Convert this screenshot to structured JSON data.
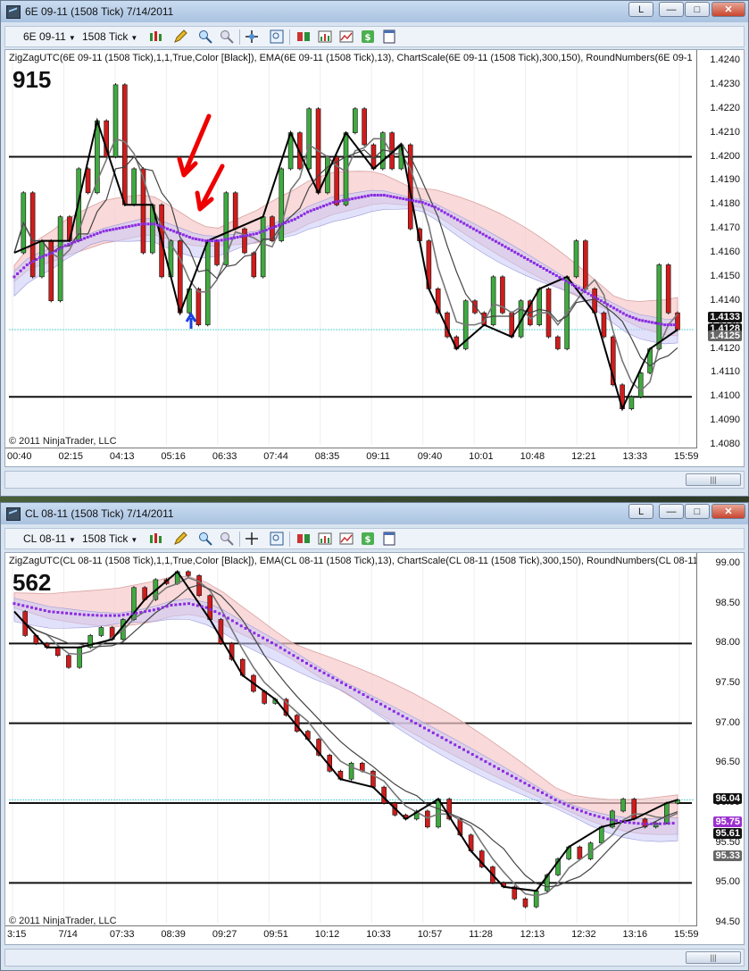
{
  "windows": [
    {
      "title": "6E 09-11 (1508 Tick)  7/14/2011",
      "buttons": {
        "l": "L",
        "minimize": "—",
        "maximize": "□",
        "close": "✕"
      },
      "toolbar": {
        "instrument": "6E 09-11",
        "interval": "1508 Tick"
      },
      "indicators": "ZigZagUTC(6E 09-11 (1508 Tick),1,1,True,Color [Black]), EMA(6E 09-11 (1508 Tick),13), ChartScale(6E 09-11 (1508 Tick),300,150), RoundNumbers(6E 09-1",
      "big_number": "915",
      "copyright": "© 2011 NinjaTrader, LLC",
      "price_ticks": [
        "1.4240",
        "1.4230",
        "1.4220",
        "1.4210",
        "1.4200",
        "1.4190",
        "1.4180",
        "1.4170",
        "1.4160",
        "1.4150",
        "1.4140",
        "1.4130",
        "1.4120",
        "1.4110",
        "1.4100",
        "1.4090",
        "1.4080"
      ],
      "price_labels": [
        {
          "text": "1.4133",
          "value": 1.4133,
          "color": "#111111"
        },
        {
          "text": "1.4128",
          "value": 1.4128,
          "color": "#111111"
        },
        {
          "text": "1.4125",
          "value": 1.4125,
          "color": "#666666"
        }
      ],
      "time_labels": [
        "00:40",
        "02:15",
        "04:13",
        "05:16",
        "06:33",
        "07:44",
        "08:35",
        "09:11",
        "09:40",
        "10:01",
        "10:48",
        "12:21",
        "13:33",
        "15:59"
      ]
    },
    {
      "title": "CL 08-11 (1508 Tick)  7/14/2011",
      "buttons": {
        "l": "L",
        "minimize": "—",
        "maximize": "□",
        "close": "✕"
      },
      "toolbar": {
        "instrument": "CL 08-11",
        "interval": "1508 Tick"
      },
      "indicators": "ZigZagUTC(CL 08-11 (1508 Tick),1,1,True,Color [Black]), EMA(CL 08-11 (1508 Tick),13), ChartScale(CL 08-11 (1508 Tick),300,150), RoundNumbers(CL 08-11",
      "big_number": "562",
      "copyright": "© 2011 NinjaTrader, LLC",
      "price_ticks": [
        "99.00",
        "98.50",
        "98.00",
        "97.50",
        "97.00",
        "96.50",
        "96.00",
        "95.50",
        "95.00",
        "94.50"
      ],
      "price_labels": [
        {
          "text": "96.04",
          "value": 96.04,
          "color": "#111111"
        },
        {
          "text": "95.75",
          "value": 95.75,
          "color": "#9b2fd0"
        },
        {
          "text": "95.61",
          "value": 95.61,
          "color": "#111111"
        },
        {
          "text": "95.33",
          "value": 95.33,
          "color": "#666666"
        }
      ],
      "time_labels": [
        "3:15",
        "7/14",
        "07:33",
        "08:39",
        "09:27",
        "09:51",
        "10:12",
        "10:33",
        "10:57",
        "11:28",
        "12:13",
        "12:32",
        "13:16",
        "15:59"
      ]
    }
  ],
  "chart_data": [
    {
      "type": "line",
      "instrument": "6E 09-11",
      "ylim": [
        1.408,
        1.424
      ],
      "horizontal_lines": [
        1.42,
        1.41
      ],
      "current_price": 1.4128,
      "close_series": [
        1.416,
        1.4185,
        1.415,
        1.4165,
        1.414,
        1.4175,
        1.4165,
        1.4195,
        1.4185,
        1.4215,
        1.42,
        1.423,
        1.418,
        1.4195,
        1.416,
        1.418,
        1.415,
        1.4165,
        1.4135,
        1.4145,
        1.413,
        1.4165,
        1.4155,
        1.4185,
        1.417,
        1.416,
        1.415,
        1.4175,
        1.4165,
        1.4195,
        1.421,
        1.4195,
        1.422,
        1.4185,
        1.42,
        1.418,
        1.421,
        1.422,
        1.4205,
        1.4195,
        1.421,
        1.4195,
        1.4205,
        1.417,
        1.4165,
        1.4145,
        1.4135,
        1.4125,
        1.412,
        1.414,
        1.4135,
        1.413,
        1.415,
        1.4135,
        1.4125,
        1.414,
        1.413,
        1.4145,
        1.4125,
        1.412,
        1.415,
        1.4165,
        1.4145,
        1.4135,
        1.4125,
        1.4105,
        1.4095,
        1.41,
        1.411,
        1.412,
        1.4155,
        1.4135,
        1.4128
      ],
      "ema_series": [
        1.415,
        1.4155,
        1.4158,
        1.416,
        1.4163,
        1.4165,
        1.4167,
        1.4169,
        1.417,
        1.4171,
        1.4172,
        1.4172,
        1.417,
        1.4168,
        1.4166,
        1.4165,
        1.4165,
        1.4166,
        1.4167,
        1.4168,
        1.417,
        1.4172,
        1.4174,
        1.4177,
        1.4179,
        1.4181,
        1.4182,
        1.4183,
        1.4184,
        1.4184,
        1.4183,
        1.4182,
        1.4181,
        1.4179,
        1.4176,
        1.4173,
        1.417,
        1.4167,
        1.4164,
        1.4161,
        1.4158,
        1.4155,
        1.4152,
        1.4149,
        1.4146,
        1.4143,
        1.414,
        1.4137,
        1.4134,
        1.4132,
        1.4131,
        1.413,
        1.413
      ],
      "arrow_annotations": 2
    },
    {
      "type": "line",
      "instrument": "CL 08-11",
      "ylim": [
        94.5,
        99.0
      ],
      "horizontal_lines": [
        98.0,
        97.0,
        96.0,
        95.0
      ],
      "current_price": 96.04,
      "close_series": [
        98.4,
        98.1,
        98.0,
        97.95,
        97.85,
        97.7,
        97.95,
        98.1,
        98.2,
        98.05,
        98.3,
        98.7,
        98.55,
        98.8,
        98.75,
        98.9,
        98.85,
        98.6,
        98.3,
        98.0,
        97.8,
        97.6,
        97.4,
        97.25,
        97.3,
        97.1,
        96.9,
        96.8,
        96.6,
        96.4,
        96.3,
        96.5,
        96.4,
        96.2,
        96.0,
        95.85,
        95.8,
        95.9,
        95.7,
        96.05,
        95.8,
        95.6,
        95.4,
        95.2,
        95.0,
        94.95,
        94.8,
        94.7,
        94.9,
        95.1,
        95.3,
        95.45,
        95.3,
        95.5,
        95.7,
        95.9,
        96.05,
        95.8,
        95.7,
        95.75,
        96.0,
        96.04
      ],
      "ema_series": [
        98.5,
        98.45,
        98.4,
        98.38,
        98.36,
        98.35,
        98.35,
        98.38,
        98.42,
        98.48,
        98.5,
        98.45,
        98.35,
        98.22,
        98.1,
        97.98,
        97.85,
        97.72,
        97.6,
        97.48,
        97.36,
        97.24,
        97.12,
        97.0,
        96.88,
        96.76,
        96.64,
        96.52,
        96.4,
        96.28,
        96.16,
        96.04,
        95.94,
        95.86,
        95.8,
        95.76,
        95.74,
        95.74,
        95.75
      ]
    }
  ]
}
